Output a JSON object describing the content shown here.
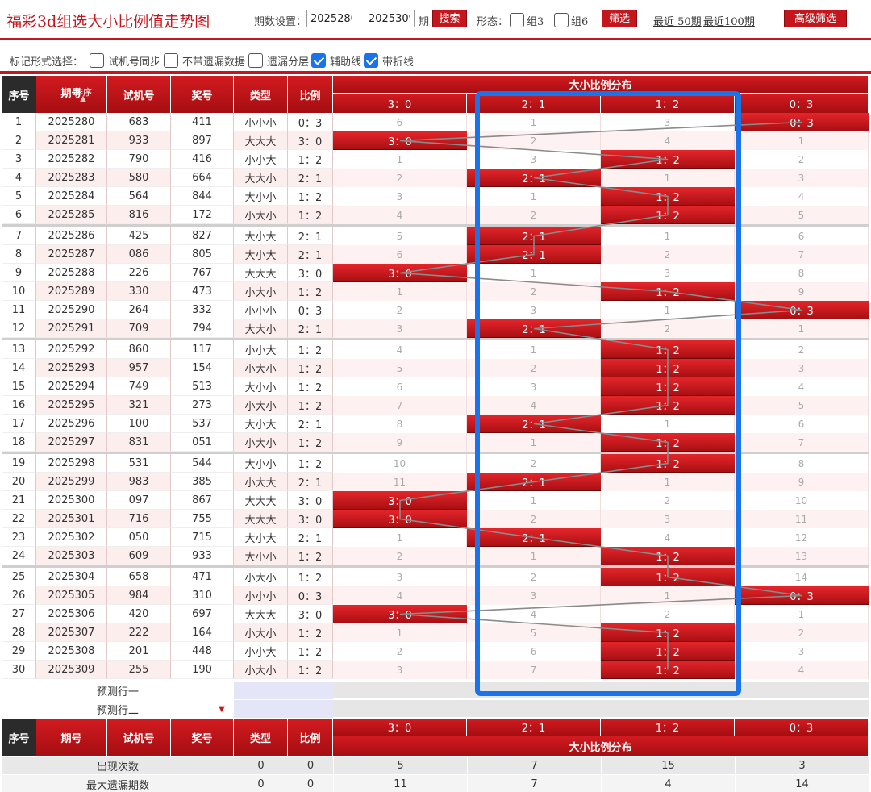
{
  "header": {
    "title": "福彩3d组选大小比例值走势图",
    "period_label": "期数设置：",
    "period_from": "2025280",
    "dash": "-",
    "period_to": "2025309",
    "period_unit": "期",
    "search_label": "搜索",
    "shape_label": "形态：",
    "group3_label": "组3",
    "group6_label": "组6",
    "filter_label": "筛选",
    "recent50_label": "最近 50期",
    "recent100_label": "最近100期",
    "advanced_label": "高级筛选"
  },
  "options": {
    "label": "标记形式选择：",
    "items": [
      {
        "label": "试机号同步",
        "checked": false
      },
      {
        "label": "不带遗漏数据",
        "checked": false
      },
      {
        "label": "遗漏分层",
        "checked": false
      },
      {
        "label": "辅助线",
        "checked": true
      },
      {
        "label": "带折线",
        "checked": true
      }
    ]
  },
  "table": {
    "headers": {
      "seq": "序号",
      "period": "期号",
      "sort": "排序",
      "trial": "试机号",
      "prize": "奖号",
      "type": "类型",
      "ratio": "比例",
      "dist": "大小比例分布"
    },
    "dist_columns": [
      "3：0",
      "2：1",
      "1：2",
      "0：3"
    ],
    "rows": [
      {
        "seq": "1",
        "period": "2025280",
        "trial": "683",
        "prize": "411",
        "type": "小小小",
        "ratio": "0：3",
        "hit": 3,
        "miss": [
          "6",
          "1",
          "3"
        ]
      },
      {
        "seq": "2",
        "period": "2025281",
        "trial": "933",
        "prize": "897",
        "type": "大大大",
        "ratio": "3：0",
        "hit": 0,
        "miss": [
          "2",
          "4",
          "1"
        ]
      },
      {
        "seq": "3",
        "period": "2025282",
        "trial": "790",
        "prize": "416",
        "type": "小小大",
        "ratio": "1：2",
        "hit": 2,
        "miss": [
          "1",
          "3",
          "2"
        ]
      },
      {
        "seq": "4",
        "period": "2025283",
        "trial": "580",
        "prize": "664",
        "type": "大大小",
        "ratio": "2：1",
        "hit": 1,
        "miss": [
          "2",
          "1",
          "3"
        ]
      },
      {
        "seq": "5",
        "period": "2025284",
        "trial": "564",
        "prize": "844",
        "type": "大小小",
        "ratio": "1：2",
        "hit": 2,
        "miss": [
          "3",
          "1",
          "4"
        ]
      },
      {
        "seq": "6",
        "period": "2025285",
        "trial": "816",
        "prize": "172",
        "type": "小大小",
        "ratio": "1：2",
        "hit": 2,
        "miss": [
          "4",
          "2",
          "5"
        ]
      },
      {
        "seq": "7",
        "period": "2025286",
        "trial": "425",
        "prize": "827",
        "type": "大小大",
        "ratio": "2：1",
        "hit": 1,
        "miss": [
          "5",
          "1",
          "6"
        ]
      },
      {
        "seq": "8",
        "period": "2025287",
        "trial": "086",
        "prize": "805",
        "type": "大小大",
        "ratio": "2：1",
        "hit": 1,
        "miss": [
          "6",
          "2",
          "7"
        ]
      },
      {
        "seq": "9",
        "period": "2025288",
        "trial": "226",
        "prize": "767",
        "type": "大大大",
        "ratio": "3：0",
        "hit": 0,
        "miss": [
          "1",
          "3",
          "8"
        ]
      },
      {
        "seq": "10",
        "period": "2025289",
        "trial": "330",
        "prize": "473",
        "type": "小大小",
        "ratio": "1：2",
        "hit": 2,
        "miss": [
          "1",
          "2",
          "9"
        ]
      },
      {
        "seq": "11",
        "period": "2025290",
        "trial": "264",
        "prize": "332",
        "type": "小小小",
        "ratio": "0：3",
        "hit": 3,
        "miss": [
          "2",
          "3",
          "1"
        ]
      },
      {
        "seq": "12",
        "period": "2025291",
        "trial": "709",
        "prize": "794",
        "type": "大大小",
        "ratio": "2：1",
        "hit": 1,
        "miss": [
          "3",
          "2",
          "1"
        ]
      },
      {
        "seq": "13",
        "period": "2025292",
        "trial": "860",
        "prize": "117",
        "type": "小小大",
        "ratio": "1：2",
        "hit": 2,
        "miss": [
          "4",
          "1",
          "2"
        ]
      },
      {
        "seq": "14",
        "period": "2025293",
        "trial": "957",
        "prize": "154",
        "type": "小大小",
        "ratio": "1：2",
        "hit": 2,
        "miss": [
          "5",
          "2",
          "3"
        ]
      },
      {
        "seq": "15",
        "period": "2025294",
        "trial": "749",
        "prize": "513",
        "type": "大小小",
        "ratio": "1：2",
        "hit": 2,
        "miss": [
          "6",
          "3",
          "4"
        ]
      },
      {
        "seq": "16",
        "period": "2025295",
        "trial": "321",
        "prize": "273",
        "type": "小大小",
        "ratio": "1：2",
        "hit": 2,
        "miss": [
          "7",
          "4",
          "5"
        ]
      },
      {
        "seq": "17",
        "period": "2025296",
        "trial": "100",
        "prize": "537",
        "type": "大小大",
        "ratio": "2：1",
        "hit": 1,
        "miss": [
          "8",
          "1",
          "6"
        ]
      },
      {
        "seq": "18",
        "period": "2025297",
        "trial": "831",
        "prize": "051",
        "type": "小大小",
        "ratio": "1：2",
        "hit": 2,
        "miss": [
          "9",
          "1",
          "7"
        ]
      },
      {
        "seq": "19",
        "period": "2025298",
        "trial": "531",
        "prize": "544",
        "type": "大小小",
        "ratio": "1：2",
        "hit": 2,
        "miss": [
          "10",
          "2",
          "8"
        ]
      },
      {
        "seq": "20",
        "period": "2025299",
        "trial": "983",
        "prize": "385",
        "type": "小大大",
        "ratio": "2：1",
        "hit": 1,
        "miss": [
          "11",
          "1",
          "9"
        ]
      },
      {
        "seq": "21",
        "period": "2025300",
        "trial": "097",
        "prize": "867",
        "type": "大大大",
        "ratio": "3：0",
        "hit": 0,
        "miss": [
          "1",
          "2",
          "10"
        ]
      },
      {
        "seq": "22",
        "period": "2025301",
        "trial": "716",
        "prize": "755",
        "type": "大大大",
        "ratio": "3：0",
        "hit": 0,
        "miss": [
          "2",
          "3",
          "11"
        ]
      },
      {
        "seq": "23",
        "period": "2025302",
        "trial": "050",
        "prize": "715",
        "type": "大小大",
        "ratio": "2：1",
        "hit": 1,
        "miss": [
          "1",
          "4",
          "12"
        ]
      },
      {
        "seq": "24",
        "period": "2025303",
        "trial": "609",
        "prize": "933",
        "type": "大小小",
        "ratio": "1：2",
        "hit": 2,
        "miss": [
          "2",
          "1",
          "13"
        ]
      },
      {
        "seq": "25",
        "period": "2025304",
        "trial": "658",
        "prize": "471",
        "type": "小大小",
        "ratio": "1：2",
        "hit": 2,
        "miss": [
          "3",
          "2",
          "14"
        ]
      },
      {
        "seq": "26",
        "period": "2025305",
        "trial": "984",
        "prize": "310",
        "type": "小小小",
        "ratio": "0：3",
        "hit": 3,
        "miss": [
          "4",
          "3",
          "1"
        ]
      },
      {
        "seq": "27",
        "period": "2025306",
        "trial": "420",
        "prize": "697",
        "type": "大大大",
        "ratio": "3：0",
        "hit": 0,
        "miss": [
          "4",
          "2",
          "1"
        ]
      },
      {
        "seq": "28",
        "period": "2025307",
        "trial": "222",
        "prize": "164",
        "type": "小大小",
        "ratio": "1：2",
        "hit": 2,
        "miss": [
          "1",
          "5",
          "2"
        ]
      },
      {
        "seq": "29",
        "period": "2025308",
        "trial": "201",
        "prize": "448",
        "type": "小小大",
        "ratio": "1：2",
        "hit": 2,
        "miss": [
          "2",
          "6",
          "3"
        ]
      },
      {
        "seq": "30",
        "period": "2025309",
        "trial": "255",
        "prize": "190",
        "type": "小大小",
        "ratio": "1：2",
        "hit": 2,
        "miss": [
          "3",
          "7",
          "4"
        ]
      }
    ],
    "predict": [
      "预测行一",
      "预测行二"
    ],
    "stats": [
      {
        "label": "出现次数",
        "type": "0",
        "ratio": "0",
        "values": [
          "5",
          "7",
          "15",
          "3"
        ]
      },
      {
        "label": "最大遗漏期数",
        "type": "0",
        "ratio": "0",
        "values": [
          "11",
          "7",
          "4",
          "14"
        ]
      }
    ]
  },
  "colors": {
    "accent": "#c4161c",
    "highlight": "#1a73e8",
    "zebra": "#fdeeee"
  }
}
